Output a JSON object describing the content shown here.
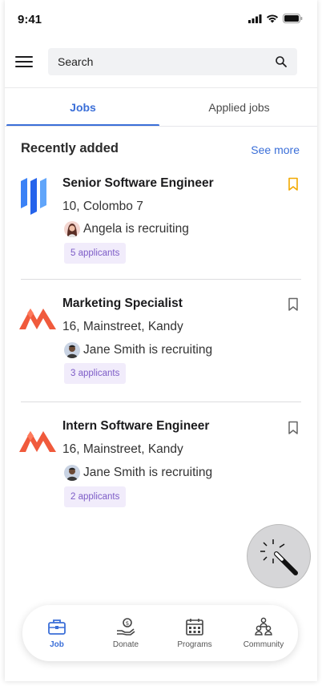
{
  "status_bar": {
    "time": "9:41"
  },
  "search": {
    "placeholder": "Search"
  },
  "tabs": [
    {
      "label": "Jobs",
      "active": true
    },
    {
      "label": "Applied jobs",
      "active": false
    }
  ],
  "section": {
    "title": "Recently added",
    "see_more": "See more"
  },
  "jobs": [
    {
      "title": "Senior Software Engineer",
      "location": "10, Colombo 7",
      "recruiter": "Angela is recruiting",
      "applicants": "5 applicants",
      "bookmarked": true,
      "logo": "bars-logo-icon"
    },
    {
      "title": "Marketing Specialist",
      "location": "16, Mainstreet, Kandy",
      "recruiter": "Jane Smith is recruiting",
      "applicants": "3 applicants",
      "bookmarked": false,
      "logo": "mountain-logo-icon"
    },
    {
      "title": "Intern Software Engineer",
      "location": "16, Mainstreet, Kandy",
      "recruiter": "Jane Smith is recruiting",
      "applicants": "2 applicants",
      "bookmarked": false,
      "logo": "mountain-logo-icon"
    }
  ],
  "bottom_nav": [
    {
      "label": "Job",
      "icon": "briefcase-icon",
      "active": true
    },
    {
      "label": "Donate",
      "icon": "donate-icon",
      "active": false
    },
    {
      "label": "Programs",
      "icon": "calendar-icon",
      "active": false
    },
    {
      "label": "Community",
      "icon": "community-icon",
      "active": false
    }
  ],
  "colors": {
    "accent": "#3b6fd8",
    "badge_bg": "#f1ecfb",
    "badge_text": "#7d5cc7",
    "bookmark_active": "#f2a900",
    "logo_blue": "#3b82f6",
    "logo_orange": "#f05a3c"
  }
}
